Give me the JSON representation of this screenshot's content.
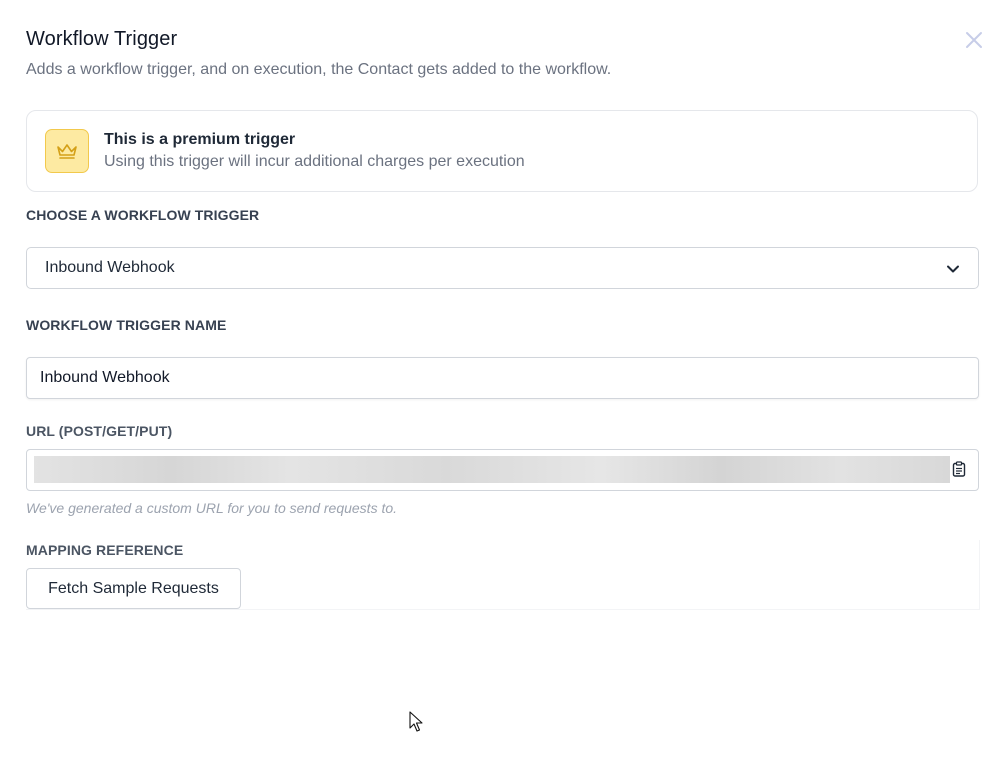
{
  "header": {
    "title": "Workflow Trigger",
    "subtitle": "Adds a workflow trigger, and on execution, the Contact gets added to the workflow.",
    "close_icon": "close-icon"
  },
  "premium_notice": {
    "icon": "crown-icon",
    "title": "This is a premium trigger",
    "description": "Using this trigger will incur additional charges per execution",
    "accent": "#f2c94c"
  },
  "trigger_select": {
    "label": "CHOOSE A WORKFLOW TRIGGER",
    "selected": "Inbound Webhook"
  },
  "trigger_name": {
    "label": "WORKFLOW TRIGGER NAME",
    "value": "Inbound Webhook"
  },
  "url_field": {
    "label": "URL (POST/GET/PUT)",
    "value": "",
    "copy_icon": "clipboard-icon",
    "hint": "We've generated a custom URL for you to send requests to."
  },
  "mapping": {
    "label": "MAPPING REFERENCE",
    "button_label": "Fetch Sample Requests"
  }
}
